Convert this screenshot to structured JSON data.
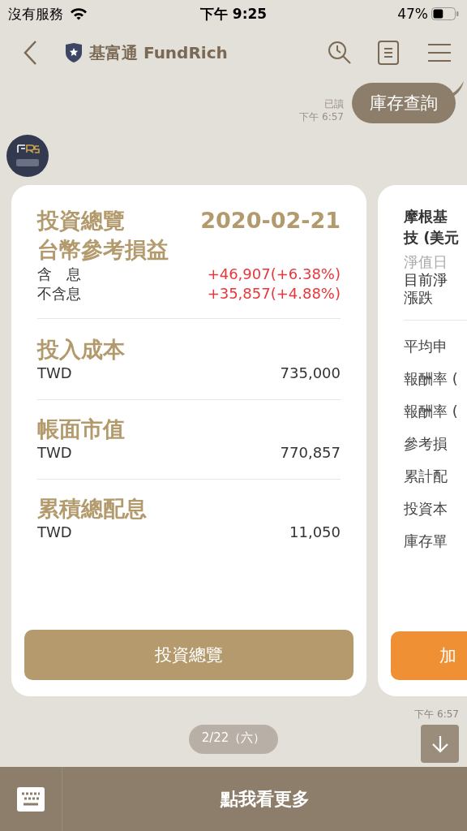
{
  "status_bar": {
    "carrier": "沒有服務",
    "time": "下午 9:25",
    "battery": "47%"
  },
  "header": {
    "title": "基富通 FundRich"
  },
  "sent_message": {
    "text": "庫存查詢",
    "read": "已讀",
    "time": "下午 6:57"
  },
  "cards": [
    {
      "kind": "summary",
      "title": "投資總覽",
      "date": "2020-02-21",
      "subtitle": "台幣參考損益",
      "pl_rows": [
        {
          "label": "含　息",
          "value": "+46,907(+6.38%)"
        },
        {
          "label": "不含息",
          "value": "+35,857(+4.88%)"
        }
      ],
      "sections": [
        {
          "title": "投入成本",
          "currency": "TWD",
          "value": "735,000"
        },
        {
          "title": "帳面市值",
          "currency": "TWD",
          "value": "770,857"
        },
        {
          "title": "累積總配息",
          "currency": "TWD",
          "value": "11,050"
        }
      ],
      "button": "投資總覽"
    },
    {
      "kind": "fund",
      "title_lines": [
        "摩根基",
        "技 (美元"
      ],
      "nav_date": "淨值日",
      "info_lines": [
        "目前淨",
        "漲跌"
      ],
      "rows": [
        "平均申",
        "報酬率 (",
        "報酬率 (",
        "參考損",
        "累計配",
        "投資本",
        "庫存單"
      ],
      "button": "加"
    }
  ],
  "message_time": "下午 6:57",
  "date_pill": "2/22（六）",
  "bottom_bar": {
    "button": "點我看更多"
  }
}
